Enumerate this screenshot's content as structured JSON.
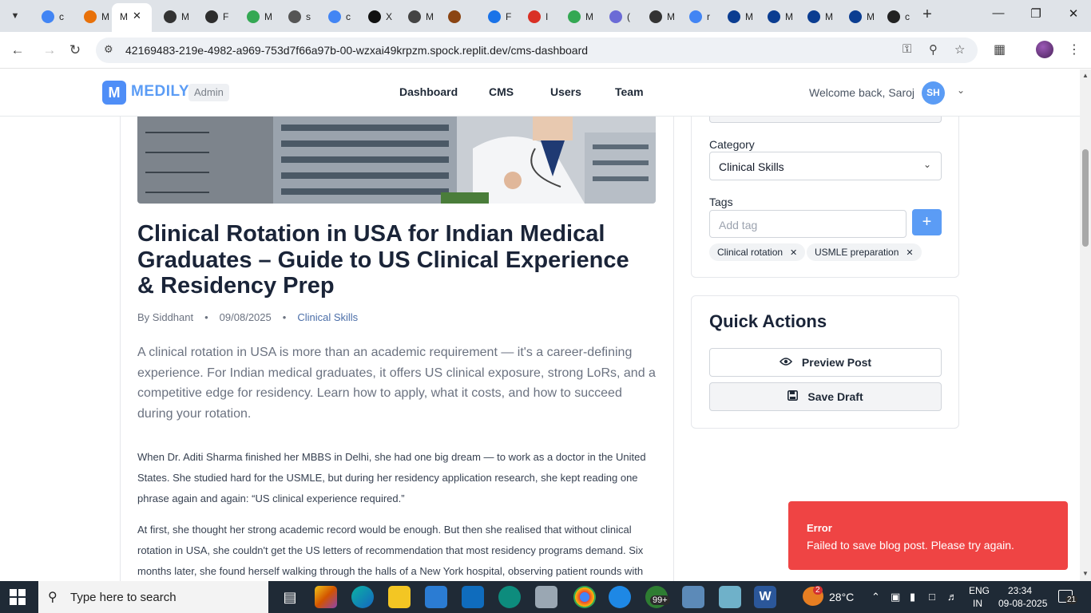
{
  "browser": {
    "tab_titles": [
      "c",
      "M",
      "M",
      "M",
      "F",
      "M",
      "s",
      "c",
      "X",
      "M",
      "",
      "F",
      "I",
      "M",
      "(",
      "M",
      "r",
      "M",
      "M",
      "M",
      "M",
      "c"
    ],
    "active_tab_title": "M",
    "url": "42169483-219e-4982-a969-753d7f66a97b-00-wzxai49krpzm.spock.replit.dev/cms-dashboard"
  },
  "header": {
    "logo_letter": "M",
    "brand": "MEDILY",
    "badge": "Admin",
    "nav": [
      "Dashboard",
      "CMS",
      "Users",
      "Team"
    ],
    "welcome": "Welcome back, Saroj",
    "avatar_initials": "SH"
  },
  "article": {
    "title": "Clinical Rotation in USA for Indian Medical Graduates – Guide to US Clinical Experience & Residency Prep",
    "author": "By Siddhant",
    "date": "09/08/2025",
    "category": "Clinical Skills",
    "excerpt": "A clinical rotation in USA is more than an academic requirement — it's a career-defining experience. For Indian medical graduates, it offers US clinical exposure, strong LoRs, and a competitive edge for residency. Learn how to apply, what it costs, and how to succeed during your rotation.",
    "paragraphs": [
      " When Dr. Aditi Sharma finished her MBBS in Delhi, she had one big dream — to work as a doctor in the  United States. She studied hard for the USMLE, but during her residency application research, she kept reading one phrase again and again: “US clinical experience required.”",
      "At first, she thought her strong academic record would be enough. But then she realised that without clinical rotation in USA, she couldn't get the US letters of recommendation that most residency programs demand. Six months later, she found herself walking through the halls of a New York hospital, observing patient rounds with"
    ]
  },
  "sidebar": {
    "category_label": "Category",
    "category_value": "Clinical Skills",
    "tags_label": "Tags",
    "tag_placeholder": "Add tag",
    "tags": [
      "Clinical rotation",
      "USMLE preparation"
    ]
  },
  "quick_actions": {
    "title": "Quick Actions",
    "preview_label": "Preview Post",
    "save_label": "Save Draft"
  },
  "toast": {
    "title": "Error",
    "message": "Failed to save blog post. Please try again."
  },
  "taskbar": {
    "search_placeholder": "Type here to search",
    "notification_count": "99+",
    "weather_badge": "2",
    "temperature": "28°C",
    "language": "ENG",
    "region": "IN",
    "time": "23:34",
    "date": "09-08-2025",
    "action_center_count": "21"
  },
  "colors": {
    "brand": "#5b9cf5",
    "error": "#ef4444",
    "title_text": "#1a2438"
  }
}
